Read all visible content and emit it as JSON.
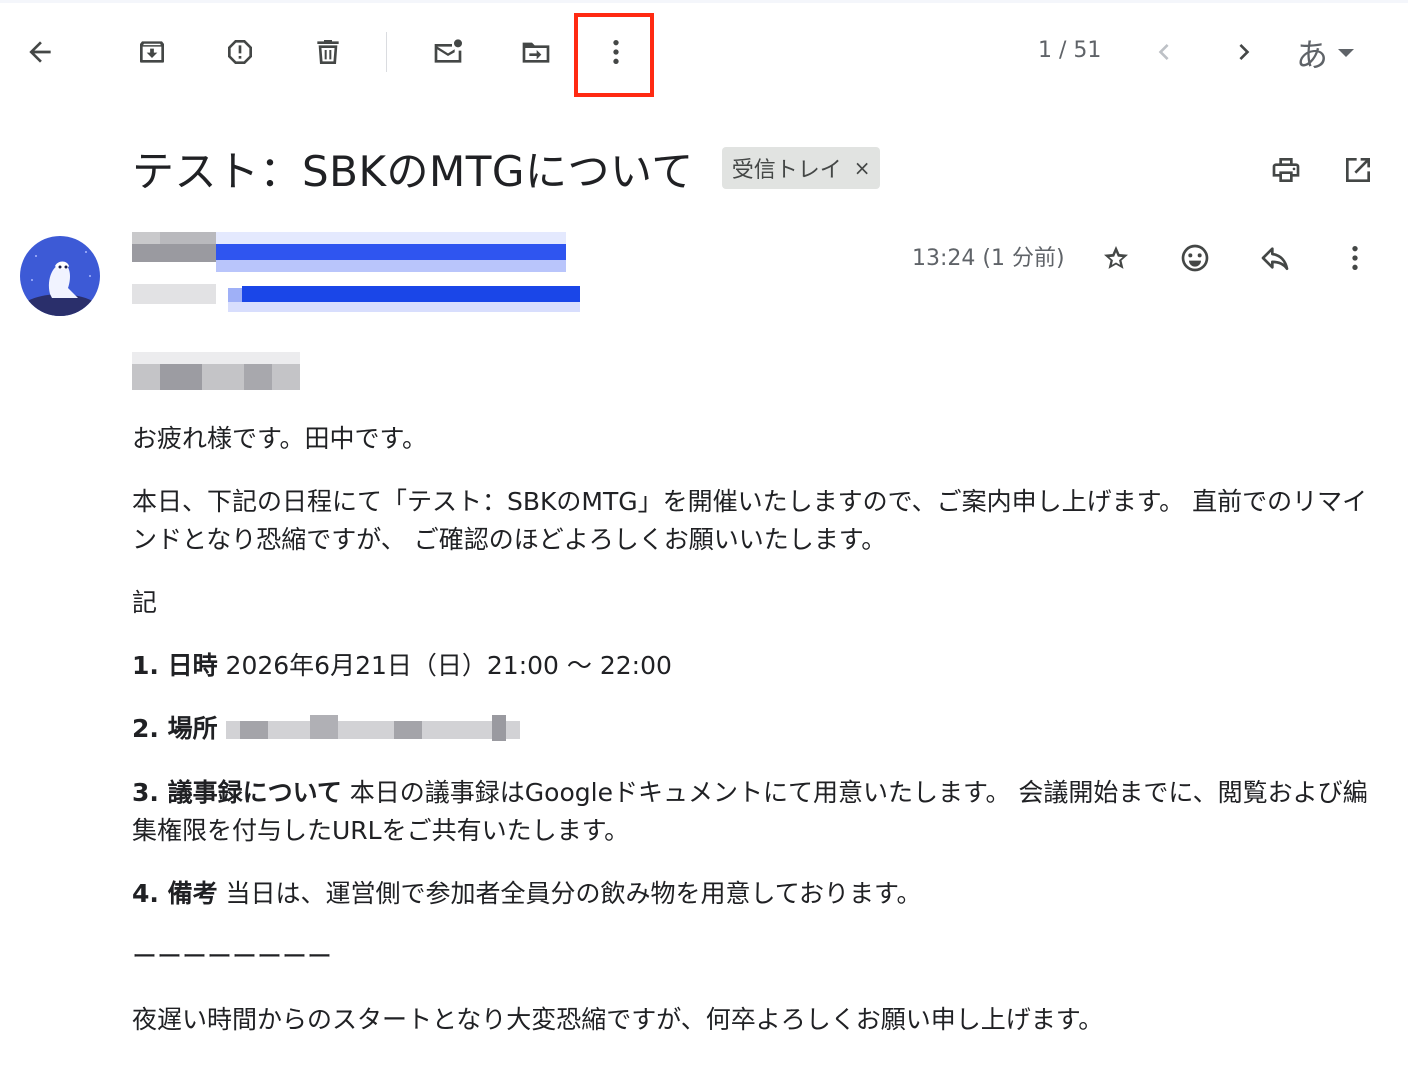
{
  "toolbar": {
    "pager": "1 / 51",
    "language_glyph": "あ",
    "icons": [
      "back-icon",
      "archive-icon",
      "report-spam-icon",
      "delete-icon",
      "mark-unread-icon",
      "move-to-icon",
      "more-icon",
      "prev-icon",
      "next-icon",
      "input-tools-icon"
    ],
    "highlight_color": "#ff2a12"
  },
  "message": {
    "subject": "テスト：SBKのMTGについて",
    "label": "受信トレイ",
    "label_remove": "×",
    "timestamp": "13:24 (1 分前)"
  },
  "body": {
    "line1": "お疲れ様です。田中です。",
    "line2": "本日、下記の日程にて「テスト：SBKのMTG」を開催いたしますので、ご案内申し上げます。 直前でのリマインドとなり恐縮ですが、 ご確認のほどよろしくお願いいたします。",
    "ki": "記",
    "item1_label": "1. 日時",
    "item1_text": " 2026年6月21日（日）21:00 〜 22:00",
    "item2_label": "2. 場所",
    "item3_label": "3. 議事録について",
    "item3_text": " 本日の議事録はGoogleドキュメントにて用意いたします。 会議開始までに、閲覧および編集権限を付与したURLをご共有いたします。",
    "item4_label": "4. 備考",
    "item4_text": " 当日は、運営側で参加者全員分の飲み物を用意しております。",
    "divider": "ーーーーーーーー",
    "closing": "夜遅い時間からのスタートとなり大変恐縮ですが、何卒よろしくお願い申し上げます。"
  },
  "colors": {
    "icon": "#444746",
    "link_blue": "#1a46e8",
    "avatar_bg": "#3d5ad6"
  }
}
